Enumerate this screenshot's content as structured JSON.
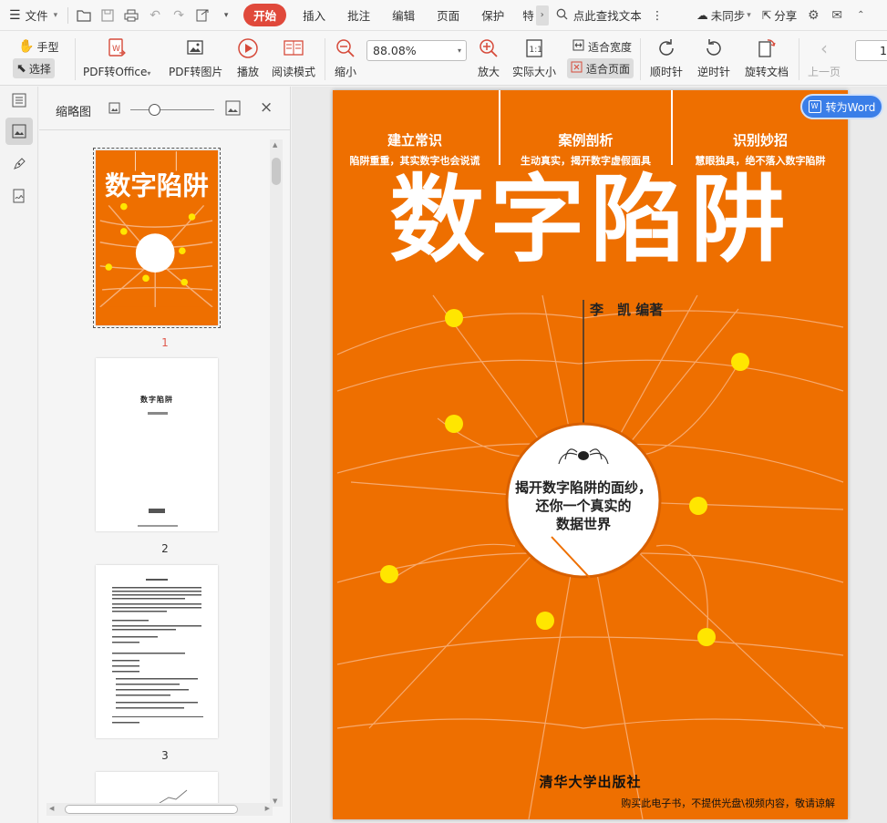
{
  "menubar": {
    "file": "文件",
    "tabs": [
      "开始",
      "插入",
      "批注",
      "编辑",
      "页面",
      "保护",
      "特"
    ],
    "active_tab": "开始",
    "search": "点此查找文本",
    "sync": "未同步",
    "share": "分享"
  },
  "toolbar": {
    "hand": "手型",
    "select": "选择",
    "pdf_to_office": "PDF转Office",
    "pdf_to_image": "PDF转图片",
    "play": "播放",
    "read_mode": "阅读模式",
    "zoom_out": "缩小",
    "zoom_value": "88.08%",
    "zoom_in": "放大",
    "actual_size": "实际大小",
    "fit_width": "适合宽度",
    "fit_page": "适合页面",
    "rotate_cw": "顺时针",
    "rotate_ccw": "逆时针",
    "rotate_doc": "旋转文档",
    "prev_page": "上一页",
    "page_number": "1"
  },
  "thumbnails": {
    "title": "缩略图",
    "pages": [
      "1",
      "2",
      "3"
    ],
    "selected": "1"
  },
  "convert_button": "转为Word",
  "cover": {
    "sections": [
      {
        "title": "建立常识",
        "subtitle": "陷阱重重，其实数字也会说谎"
      },
      {
        "title": "案例剖析",
        "subtitle": "生动真实，揭开数字虚假面具"
      },
      {
        "title": "识别妙招",
        "subtitle": "慧眼独具，绝不落入数字陷阱"
      }
    ],
    "main_title": "数字陷阱",
    "author": "李　凯 编著",
    "circle_text": [
      "揭开数字陷阱的面纱，",
      "还你一个真实的",
      "数据世界"
    ],
    "publisher": "清华大学出版社",
    "notice": "购买此电子书，不提供光盘\\视频内容，敬请谅解",
    "thumb_page2_title": "数字陷阱"
  },
  "colors": {
    "cover_orange": "#ee6f00",
    "accent_red": "#e0493b",
    "convert_blue": "#3a7ee8",
    "dot_yellow": "#ffe600"
  }
}
